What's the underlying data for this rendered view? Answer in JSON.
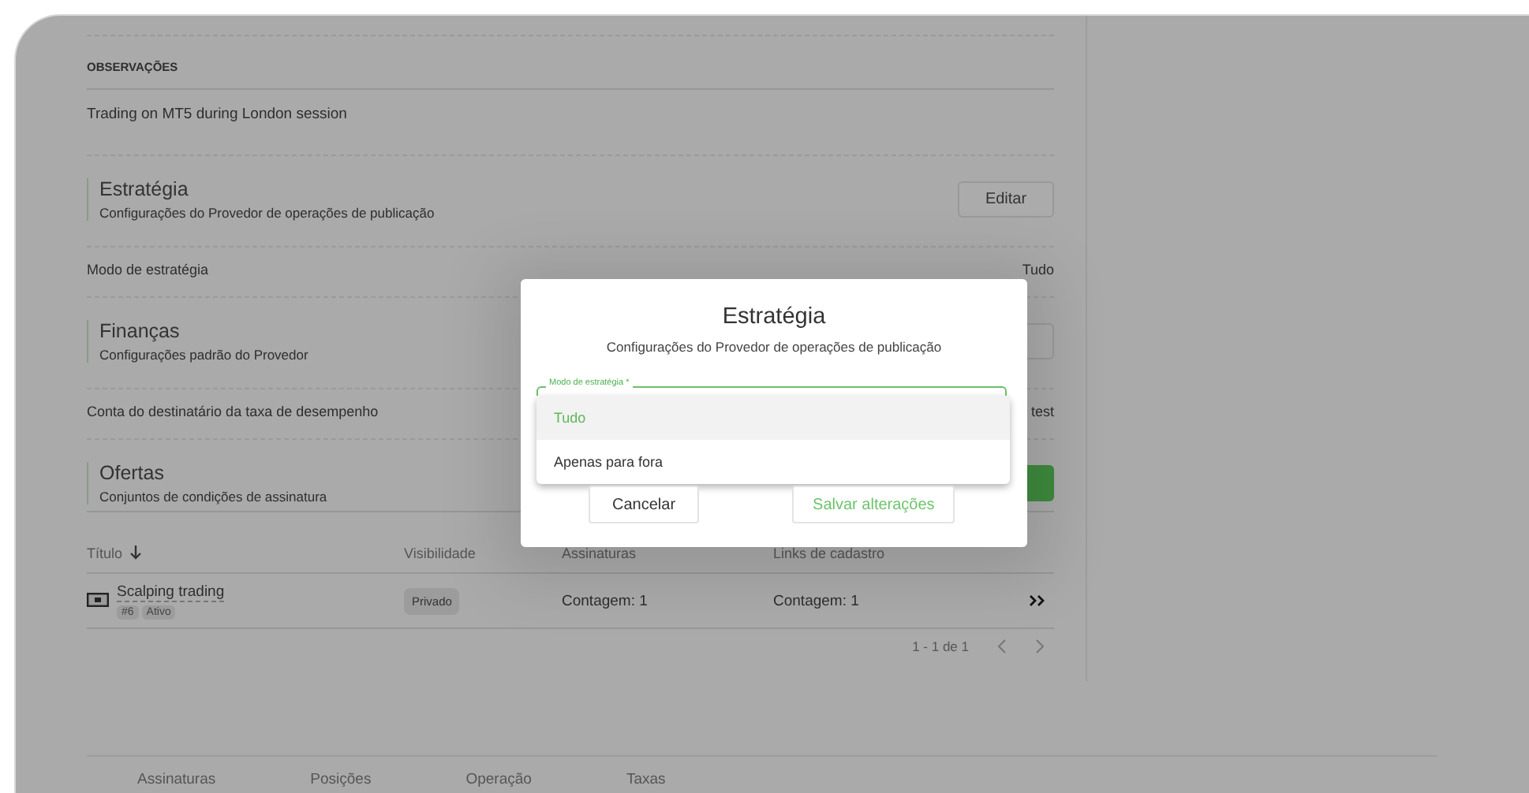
{
  "notes": {
    "heading": "OBSERVAÇÕES",
    "text": "Trading on MT5 during London session"
  },
  "sections": [
    {
      "title": "Estratégia",
      "subtitle": "Configurações do Provedor de operações de publicação",
      "action": {
        "kind": "outline",
        "label": "Editar"
      },
      "row": {
        "label": "Modo de estratégia",
        "value": "Tudo"
      }
    },
    {
      "title": "Finanças",
      "subtitle": "Configurações padrão do Provedor",
      "action": {
        "kind": "outline"
      },
      "row": {
        "label": "Conta do destinatário da taxa de desempenho",
        "value": "test"
      }
    },
    {
      "title": "Ofertas",
      "subtitle": "Conjuntos de condições de assinatura",
      "action": {
        "kind": "primary"
      }
    }
  ],
  "table": {
    "columns": [
      "Título",
      "Visibilidade",
      "Assinaturas",
      "Links de cadastro"
    ],
    "rows": [
      {
        "title": "Scalping trading",
        "tags": [
          "#6",
          "Ativo"
        ],
        "visibility": "Privado",
        "subscriptions": "Contagem: 1",
        "links": "Contagem: 1"
      }
    ],
    "pagination": "1 - 1 de 1"
  },
  "bottom_tabs": [
    "Assinaturas",
    "Posições",
    "Operação",
    "Taxas"
  ],
  "modal": {
    "title": "Estratégia",
    "subtitle": "Configurações do Provedor de operações de publicação",
    "field_label": "Modo de estratégia *",
    "options": [
      {
        "label": "Tudo",
        "selected": true
      },
      {
        "label": "Apenas para fora",
        "selected": false
      }
    ],
    "buttons": [
      {
        "label": "Cancelar",
        "kind": "plain"
      },
      {
        "label": "Salvar alterações",
        "kind": "accent"
      }
    ]
  }
}
